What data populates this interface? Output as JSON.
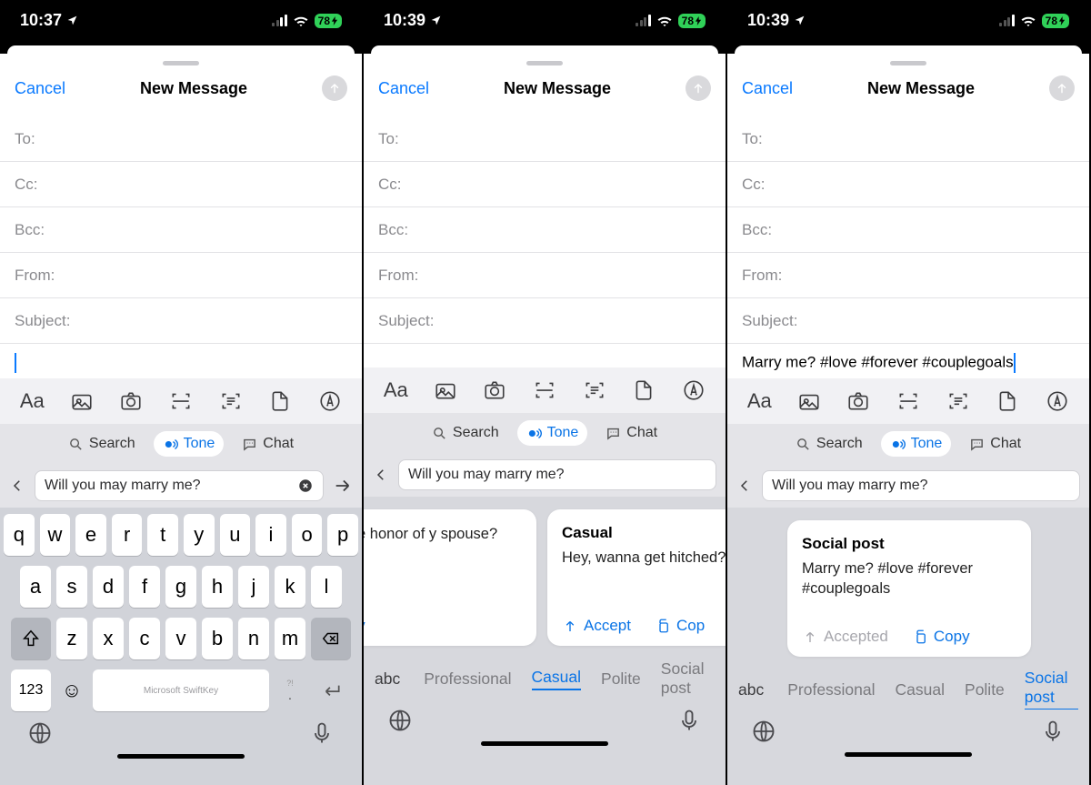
{
  "screens": [
    {
      "statusbar": {
        "time": "10:37",
        "battery": "78"
      },
      "modal": {
        "cancel": "Cancel",
        "title": "New Message"
      },
      "fields": {
        "to": "To:",
        "cc": "Cc:",
        "bcc": "Bcc:",
        "from": "From:",
        "subject": "Subject:"
      },
      "body_text": "",
      "toolbar": {
        "search": "Search",
        "tone": "Tone",
        "chat": "Chat",
        "tone_active": true
      },
      "tone_input": "Will you may marry me?",
      "tone_has_clear": true,
      "tone_has_go": true,
      "keyboard": {
        "row1": [
          "q",
          "w",
          "e",
          "r",
          "t",
          "y",
          "u",
          "i",
          "o",
          "p"
        ],
        "row2": [
          "a",
          "s",
          "d",
          "f",
          "g",
          "h",
          "j",
          "k",
          "l"
        ],
        "row3": [
          "z",
          "x",
          "c",
          "v",
          "b",
          "n",
          "m"
        ],
        "numeric": "123",
        "space_brand": "Microsoft SwiftKey",
        "punct_top": "?!",
        "punct_bot": "."
      }
    },
    {
      "statusbar": {
        "time": "10:39",
        "battery": "78"
      },
      "modal": {
        "cancel": "Cancel",
        "title": "New Message"
      },
      "fields": {
        "to": "To:",
        "cc": "Cc:",
        "bcc": "Bcc:",
        "from": "From:",
        "subject": "Subject:"
      },
      "body_text": "",
      "toolbar": {
        "search": "Search",
        "tone": "Tone",
        "chat": "Chat",
        "tone_active": true
      },
      "tone_input": "Will you may marry me?",
      "cards": [
        {
          "title": "",
          "body": "o me the honor of y spouse?",
          "actions": [
            {
              "label": "Copy",
              "icon": "copy"
            }
          ]
        },
        {
          "title": "Casual",
          "body": "Hey, wanna get hitched?",
          "actions": [
            {
              "label": "Accept",
              "icon": "accept"
            },
            {
              "label": "Cop",
              "icon": "copy"
            }
          ]
        }
      ],
      "tabs": {
        "abc": "abc",
        "items": [
          "Professional",
          "Casual",
          "Polite",
          "Social post"
        ],
        "selected": "Casual"
      }
    },
    {
      "statusbar": {
        "time": "10:39",
        "battery": "78"
      },
      "modal": {
        "cancel": "Cancel",
        "title": "New Message"
      },
      "fields": {
        "to": "To:",
        "cc": "Cc:",
        "bcc": "Bcc:",
        "from": "From:",
        "subject": "Subject:"
      },
      "body_text": "Marry me? #love #forever #couplegoals",
      "toolbar": {
        "search": "Search",
        "tone": "Tone",
        "chat": "Chat",
        "tone_active": true
      },
      "tone_input": "Will you may marry me?",
      "cards": [
        {
          "title": "Social post",
          "body": "Marry me? #love #forever #couplegoals",
          "actions": [
            {
              "label": "Accepted",
              "icon": "accept",
              "dim": true
            },
            {
              "label": "Copy",
              "icon": "copy"
            }
          ]
        }
      ],
      "tabs": {
        "abc": "abc",
        "items": [
          "Professional",
          "Casual",
          "Polite",
          "Social post"
        ],
        "selected": "Social post"
      }
    }
  ]
}
